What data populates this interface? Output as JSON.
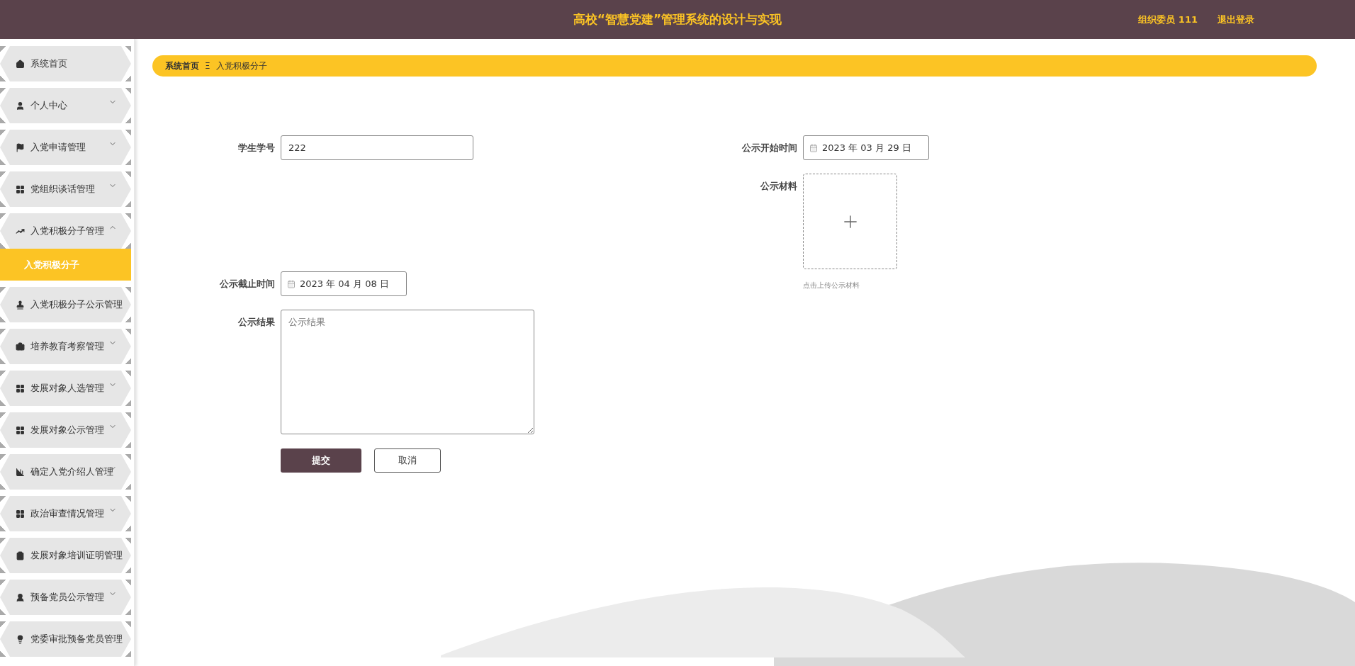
{
  "header": {
    "title": "高校“智慧党建”管理系统的设计与实现",
    "user": "组织委员 111",
    "logout": "退出登录"
  },
  "sidebar": {
    "items": [
      {
        "label": "系统首页"
      },
      {
        "label": "个人中心",
        "expanded": false
      },
      {
        "label": "入党申请管理",
        "expanded": false
      },
      {
        "label": "党组织谈话管理",
        "expanded": false
      },
      {
        "label": "入党积极分子管理",
        "expanded": true,
        "children": [
          {
            "label": "入党积极分子",
            "selected": true
          }
        ]
      },
      {
        "label": "入党积极分子公示管理"
      },
      {
        "label": "培养教育考察管理",
        "expanded": false
      },
      {
        "label": "发展对象人选管理",
        "expanded": false
      },
      {
        "label": "发展对象公示管理",
        "expanded": false
      },
      {
        "label": "确定入党介绍人管理",
        "expanded": false
      },
      {
        "label": "政治审查情况管理",
        "expanded": false
      },
      {
        "label": "发展对象培训证明管理"
      },
      {
        "label": "预备党员公示管理",
        "expanded": false
      },
      {
        "label": "党委审批预备党员管理"
      }
    ]
  },
  "breadcrumb": {
    "home": "系统首页",
    "separator": "Ξ",
    "current": "入党积极分子"
  },
  "form": {
    "student_id": {
      "label": "学生学号",
      "value": "222"
    },
    "start_time": {
      "label": "公示开始时间",
      "value": "2023 年 03 月 29 日"
    },
    "material": {
      "label": "公示材料",
      "hint": "点击上传公示材料"
    },
    "end_time": {
      "label": "公示截止时间",
      "value": "2023 年 04 月 08 日"
    },
    "result": {
      "label": "公示结果",
      "placeholder": "公示结果"
    },
    "buttons": [
      {
        "label": "提交",
        "kind": "primary"
      },
      {
        "label": "取消",
        "kind": "secondary"
      }
    ]
  }
}
